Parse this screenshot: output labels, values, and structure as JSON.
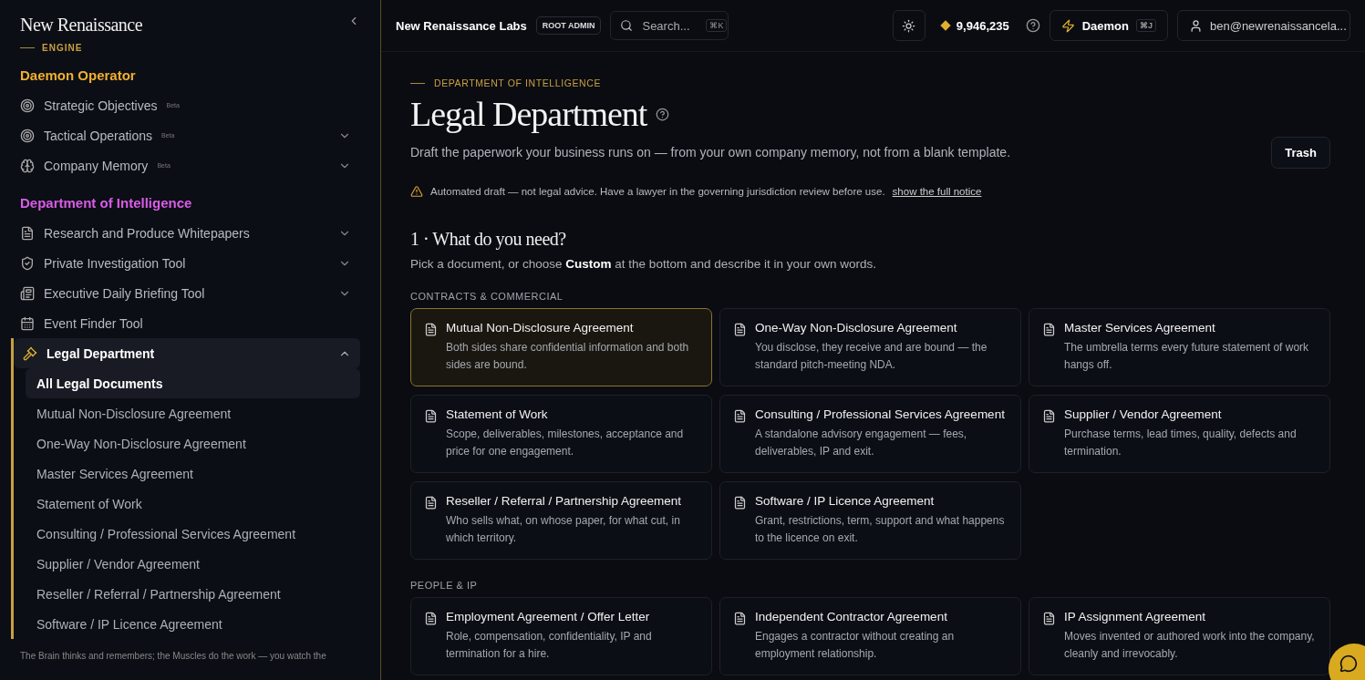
{
  "brand": {
    "name": "New Renaissance",
    "tag": "ENGINE"
  },
  "sidebar": {
    "sections": [
      {
        "title": "Daemon Operator",
        "color": "#f0b030",
        "items": [
          {
            "label": "Strategic Objectives",
            "beta": "Beta",
            "selected": false
          },
          {
            "label": "Tactical Operations",
            "beta": "Beta",
            "expanded": false,
            "selected": false
          },
          {
            "label": "Company Memory",
            "beta": "Beta",
            "expanded": false,
            "selected": false
          }
        ]
      },
      {
        "title": "Department of Intelligence",
        "color": "#d95ce8",
        "items": [
          {
            "label": "Research and Produce Whitepapers",
            "expanded": false,
            "selected": false
          },
          {
            "label": "Private Investigation Tool",
            "expanded": false,
            "selected": false
          },
          {
            "label": "Executive Daily Briefing Tool",
            "expanded": false,
            "selected": false
          },
          {
            "label": "Event Finder Tool",
            "selected": false
          },
          {
            "label": "Legal Department",
            "expanded": true,
            "selected": true,
            "children": [
              {
                "label": "All Legal Documents",
                "selected": true
              },
              {
                "label": "Mutual Non-Disclosure Agreement",
                "selected": false
              },
              {
                "label": "One-Way Non-Disclosure Agreement",
                "selected": false
              },
              {
                "label": "Master Services Agreement",
                "selected": false
              },
              {
                "label": "Statement of Work",
                "selected": false
              },
              {
                "label": "Consulting / Professional Services Agreement",
                "selected": false
              },
              {
                "label": "Supplier / Vendor Agreement",
                "selected": false
              },
              {
                "label": "Reseller / Referral / Partnership Agreement",
                "selected": false
              },
              {
                "label": "Software / IP Licence Agreement",
                "selected": false
              }
            ]
          }
        ]
      }
    ],
    "footer": "The Brain thinks and remembers; the Muscles do the work — you watch the"
  },
  "topbar": {
    "org": "New Renaissance Labs",
    "role": "ROOT ADMIN",
    "search": {
      "placeholder": "Search...",
      "shortcut": "⌘K"
    },
    "credits": "9,946,235",
    "daemon": {
      "label": "Daemon",
      "shortcut": "⌘J"
    },
    "user": "ben@newrenaissancela..."
  },
  "page": {
    "eyebrow": "DEPARTMENT OF INTELLIGENCE",
    "title": "Legal Department",
    "subtitle": "Draft the paperwork your business runs on — from your own company memory, not from a blank template.",
    "action": "Trash",
    "notice": {
      "text": "Automated draft — not legal advice. Have a lawyer in the governing jurisdiction review before use.",
      "link": "show the full notice"
    },
    "step": {
      "title": "1 · What do you need?",
      "hint": "Pick a document, or choose **Custom** at the bottom and describe it in your own words."
    },
    "groups": [
      {
        "title": "CONTRACTS & COMMERCIAL",
        "cards": [
          {
            "title": "Mutual Non-Disclosure Agreement",
            "desc": "Both sides share confidential information and both sides are bound.",
            "selected": true
          },
          {
            "title": "One-Way Non-Disclosure Agreement",
            "desc": "You disclose, they receive and are bound — the standard pitch-meeting NDA.",
            "selected": false
          },
          {
            "title": "Master Services Agreement",
            "desc": "The umbrella terms every future statement of work hangs off.",
            "selected": false
          },
          {
            "title": "Statement of Work",
            "desc": "Scope, deliverables, milestones, acceptance and price for one engagement.",
            "selected": false
          },
          {
            "title": "Consulting / Professional Services Agreement",
            "desc": "A standalone advisory engagement — fees, deliverables, IP and exit.",
            "selected": false
          },
          {
            "title": "Supplier / Vendor Agreement",
            "desc": "Purchase terms, lead times, quality, defects and termination.",
            "selected": false
          },
          {
            "title": "Reseller / Referral / Partnership Agreement",
            "desc": "Who sells what, on whose paper, for what cut, in which territory.",
            "selected": false
          },
          {
            "title": "Software / IP Licence Agreement",
            "desc": "Grant, restrictions, term, support and what happens to the licence on exit.",
            "selected": false
          }
        ]
      },
      {
        "title": "PEOPLE & IP",
        "cards": [
          {
            "title": "Employment Agreement / Offer Letter",
            "desc": "Role, compensation, confidentiality, IP and termination for a hire.",
            "selected": false
          },
          {
            "title": "Independent Contractor Agreement",
            "desc": "Engages a contractor without creating an employment relationship.",
            "selected": false
          },
          {
            "title": "IP Assignment Agreement",
            "desc": "Moves invented or authored work into the company, cleanly and irrevocably.",
            "selected": false
          }
        ]
      }
    ]
  }
}
